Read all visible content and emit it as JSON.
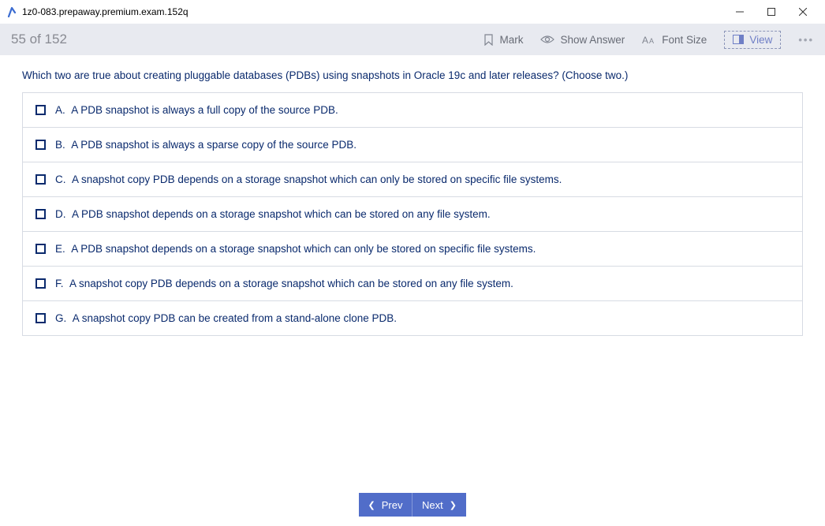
{
  "window": {
    "title": "1z0-083.prepaway.premium.exam.152q"
  },
  "toolbar": {
    "progress": "55 of 152",
    "mark_label": "Mark",
    "show_answer_label": "Show Answer",
    "font_size_label": "Font Size",
    "view_label": "View"
  },
  "question": {
    "text": "Which two are true about creating pluggable databases (PDBs) using snapshots in Oracle 19c and later releases? (Choose two.)",
    "options": [
      {
        "letter": "A.",
        "text": "A PDB snapshot is always a full copy of the source PDB."
      },
      {
        "letter": "B.",
        "text": "A PDB snapshot is always a sparse copy of the source PDB."
      },
      {
        "letter": "C.",
        "text": "A snapshot copy PDB depends on a storage snapshot which can only be stored on specific file systems."
      },
      {
        "letter": "D.",
        "text": "A PDB snapshot depends on a storage snapshot which can be stored on any file system."
      },
      {
        "letter": "E.",
        "text": "A PDB snapshot depends on a storage snapshot which can only be stored on specific file systems."
      },
      {
        "letter": "F.",
        "text": "A snapshot copy PDB depends on a storage snapshot which can be stored on any file system."
      },
      {
        "letter": "G.",
        "text": "A snapshot copy PDB can be created from a stand-alone clone PDB."
      }
    ]
  },
  "footer": {
    "prev_label": "Prev",
    "next_label": "Next"
  }
}
